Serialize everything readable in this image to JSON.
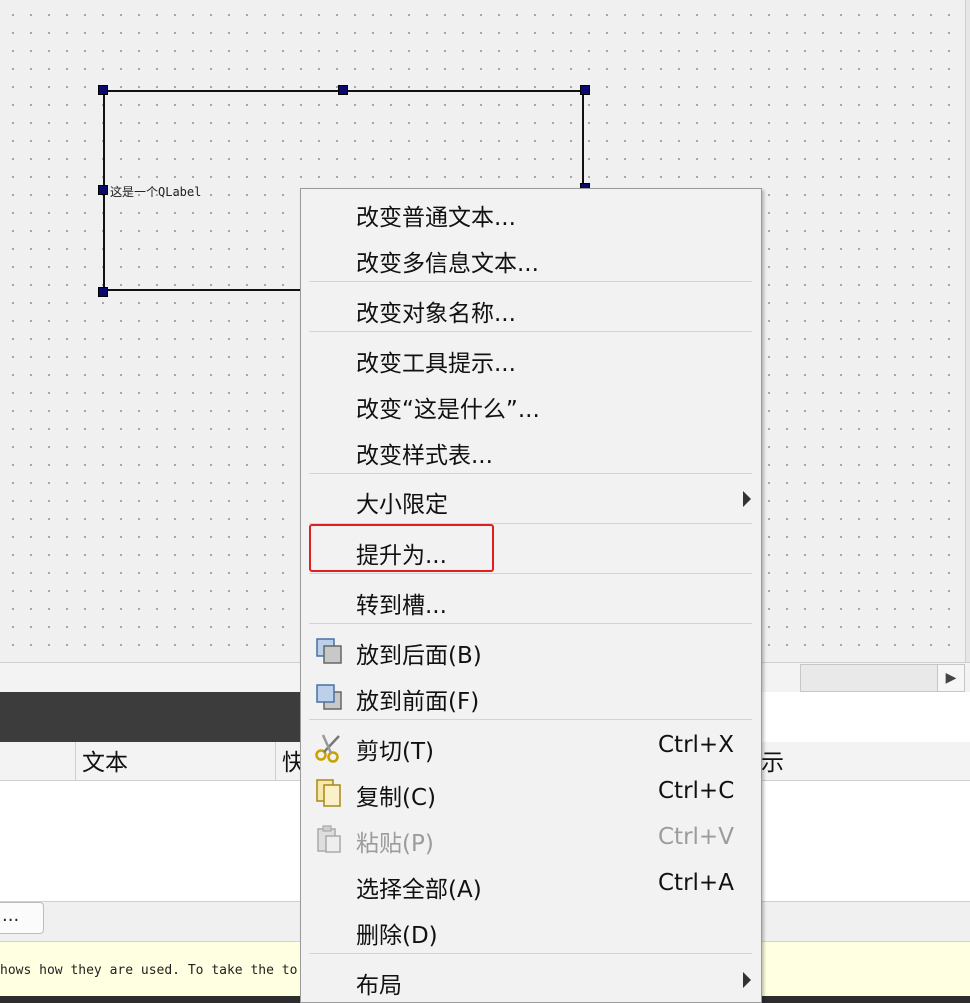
{
  "canvas": {
    "qlabel_text": "这是一个QLabel"
  },
  "table": {
    "headers": [
      "文本",
      "快",
      "示"
    ]
  },
  "tabs": {
    "more_label": "..."
  },
  "hint_bar": {
    "text": "hows how they are used. To take the to"
  },
  "context_menu": {
    "items": [
      {
        "label": "改变普通文本..."
      },
      {
        "label": "改变多信息文本..."
      },
      {
        "label": "改变对象名称..."
      },
      {
        "label": "改变工具提示..."
      },
      {
        "label": "改变“这是什么”..."
      },
      {
        "label": "改变样式表..."
      },
      {
        "label": "大小限定"
      },
      {
        "label": "提升为..."
      },
      {
        "label": "转到槽..."
      },
      {
        "label": "放到后面(B)"
      },
      {
        "label": "放到前面(F)"
      },
      {
        "label": "剪切(T)",
        "shortcut": "Ctrl+X"
      },
      {
        "label": "复制(C)",
        "shortcut": "Ctrl+C"
      },
      {
        "label": "粘贴(P)",
        "shortcut": "Ctrl+V"
      },
      {
        "label": "选择全部(A)",
        "shortcut": "Ctrl+A"
      },
      {
        "label": "删除(D)"
      },
      {
        "label": "布局"
      }
    ]
  },
  "colors": {
    "highlight": "#e02020",
    "handle": "#0a0a6e",
    "hint_background": "#ffffe1"
  }
}
